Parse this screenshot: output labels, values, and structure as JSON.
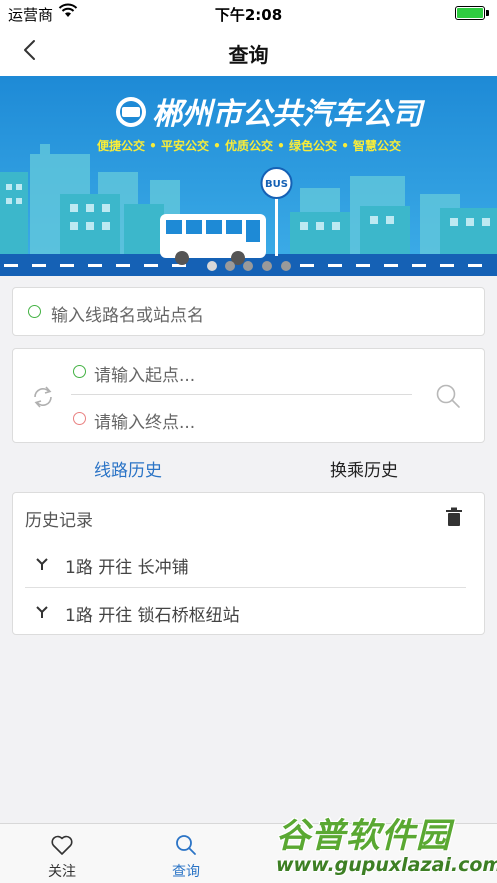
{
  "status_bar": {
    "carrier": "运营商",
    "time": "下午2:08"
  },
  "nav": {
    "title": "查询"
  },
  "banner": {
    "company_name": "郴州市公共汽车公司",
    "slogan": "便捷公交 • 平安公交 • 优质公交 • 绿色公交 • 智慧公交",
    "bus_sign": "BUS",
    "colors": {
      "sky": "#1e87d2",
      "road": "#1561b5",
      "building": "#3fb6c9"
    }
  },
  "line_search": {
    "placeholder": "输入线路名或站点名"
  },
  "station_search": {
    "start_placeholder": "请输入起点...",
    "end_placeholder": "请输入终点..."
  },
  "tabs": {
    "line_history": "线路历史",
    "transfer_history": "换乘历史"
  },
  "history": {
    "header": "历史记录",
    "items": [
      {
        "text": "1路 开往 长冲铺"
      },
      {
        "text": "1路 开往 锁石桥枢纽站"
      }
    ]
  },
  "tabbar": {
    "items": [
      {
        "label": "关注",
        "icon": "heart-icon"
      },
      {
        "label": "查询",
        "icon": "search-icon",
        "active": true
      },
      {
        "label": "",
        "icon": "unknown-icon"
      },
      {
        "label": "",
        "icon": "unknown-icon"
      }
    ]
  },
  "watermark": {
    "name": "谷普软件园",
    "url": "www.gupuxlazai.com"
  },
  "colors": {
    "accent": "#2b74c6",
    "start_dot": "#44b244",
    "end_dot": "#e98181"
  }
}
